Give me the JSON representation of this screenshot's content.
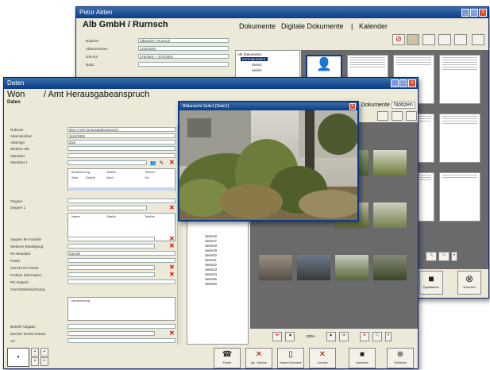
{
  "back_window": {
    "title": "Petur Akten",
    "company": "Alb GmbH / Rurnsch",
    "tabs": [
      "Dokumente",
      "Digitale Dokumente",
      "Kalender"
    ],
    "separator": "|",
    "fields": [
      {
        "label": "Rubrum",
        "value": "AlbGmbH / Rurnsch"
      },
      {
        "label": "Aktenzeichen",
        "value": "1234/2002"
      },
      {
        "label": "USt-Kz.",
        "value": "376/2002 + 27/1/2002"
      },
      {
        "label": "Notiz",
        "value": ""
      }
    ],
    "tree_root": "Alb Dokumente",
    "tree_folder": "Korrespondenz",
    "tree_items": [
      "Seite1",
      "Seite2"
    ],
    "bottom_buttons": [
      "Digitalisieren",
      "Schließen"
    ]
  },
  "front_window": {
    "title": "Daten",
    "header_1": "Won",
    "header_2": "/ Amt",
    "header_3": "Herausgabeanspruch",
    "subheader": "Daten",
    "labels": [
      "Rubrum",
      "Aktenzeichen",
      "Aktentyp",
      "Weitere Akt.",
      "Mandant",
      "Mandant 1",
      "Gegner",
      "Gegner 1",
      "Gegner RA Kanzlei",
      "Weiterer Beteiligung",
      "RA Mandant",
      "Partei",
      "Gericht RA Partei",
      "Freitext Information",
      "RS Gegner",
      "Gerichtsbezeichnung",
      "Betreff Aufgabe",
      "Zweiter Termin Datum",
      "AZ"
    ],
    "values": [
      "Won / Amt Herausgabeanspruch",
      "1122/2002",
      "Zivil",
      "",
      "",
      "",
      "",
      "",
      "",
      "",
      "Kanzlei",
      "",
      "",
      "",
      "",
      "",
      "",
      "",
      ""
    ],
    "grid1_head": [
      "Bezeichnung",
      "Straße",
      "Telefon"
    ],
    "grid1_sub": [
      "Won",
      "Straße",
      "Nord",
      "Ort"
    ],
    "grid2_head": [
      "Name",
      "Straße",
      "Telefon"
    ],
    "grid3_head": [
      "Bezeichnung"
    ],
    "tree_items": [
      "Seite16",
      "Seite17",
      "Seite18",
      "Seite19",
      "Seite20",
      "Seite21",
      "Seite22",
      "Seite23",
      "Seite24",
      "Seite25",
      "Seite26"
    ],
    "tabs": [
      "Dokumente",
      "Notizen"
    ],
    "zoom": "100%",
    "bottom_buttons": [
      "Finden",
      "Ign. Löschen",
      "Neues Dokument",
      "Löschen",
      "Speichern",
      "Schließen"
    ]
  },
  "popup": {
    "title": "Bildansicht Seite1 [Seite1]"
  }
}
